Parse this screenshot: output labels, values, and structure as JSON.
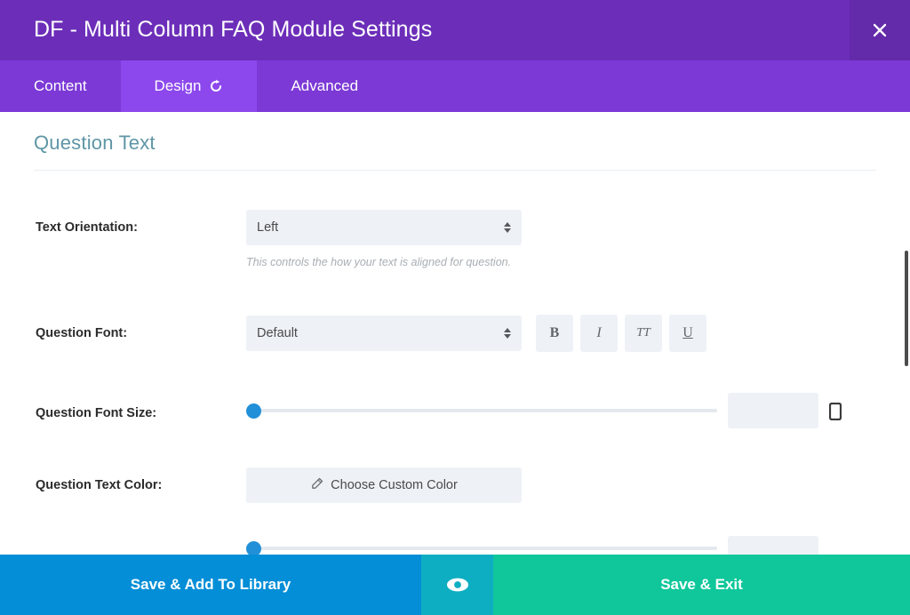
{
  "header": {
    "title": "DF - Multi Column FAQ Module Settings",
    "close_label": "×",
    "bg_color": "#6c2eb9"
  },
  "tabs": [
    {
      "label": "Content",
      "active": false,
      "has_reset_icon": false
    },
    {
      "label": "Design",
      "active": true,
      "has_reset_icon": true
    },
    {
      "label": "Advanced",
      "active": false,
      "has_reset_icon": false
    }
  ],
  "section": {
    "title": "Question Text",
    "title_color": "#5f96a6"
  },
  "fields": {
    "text_orientation": {
      "label": "Text Orientation:",
      "value": "Left",
      "help": "This controls the how your text is aligned for question."
    },
    "question_font": {
      "label": "Question Font:",
      "value": "Default",
      "style_buttons": [
        {
          "name": "bold",
          "glyph": "B"
        },
        {
          "name": "italic",
          "glyph": "I"
        },
        {
          "name": "uppercase",
          "glyph": "TT"
        },
        {
          "name": "underline",
          "glyph": "U"
        }
      ]
    },
    "question_font_size": {
      "label": "Question Font Size:",
      "value": "",
      "slider_percent": 0,
      "handle_color": "#2190d8",
      "responsive_icon": "mobile-icon"
    },
    "question_text_color": {
      "label": "Question Text Color:",
      "button_label": "Choose Custom Color",
      "icon": "eyedropper-icon"
    }
  },
  "footer": {
    "save_library_label": "Save & Add To Library",
    "save_library_color": "#038ed7",
    "preview_icon": "eye-icon",
    "preview_color": "#0eaec2",
    "save_exit_label": "Save & Exit",
    "save_exit_color": "#0fc79b"
  }
}
